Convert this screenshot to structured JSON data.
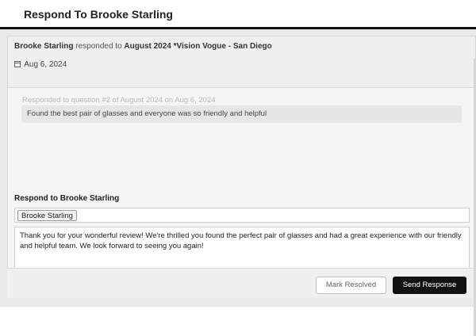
{
  "modal": {
    "title": "Respond To Brooke Starling"
  },
  "review": {
    "responder_name": "Brooke Starling",
    "responded_to_text": " responded to ",
    "survey_name": "August 2024 *Vision Vogue - San Diego",
    "date": "Aug 6, 2024",
    "question_meta": "Responded to question #2 of August 2024 on Aug 6, 2024",
    "answer": "Found the best pair of glasses and everyone was so friendly and helpful"
  },
  "response_form": {
    "label": "Respond to Brooke Starling",
    "recipient": "Brooke Starling",
    "message": "Thank you for your wonderful review! We're thrilled you found the perfect pair of glasses and had a great experience with our friendly and helpful team. We look forward to seeing you again!"
  },
  "actions": {
    "mark_resolved_label": "Mark Resolved",
    "send_label": "Send Response"
  },
  "colors": {
    "primary_button": "#111111",
    "header_border": "#111111"
  },
  "icons": {
    "date": "calendar-icon"
  }
}
